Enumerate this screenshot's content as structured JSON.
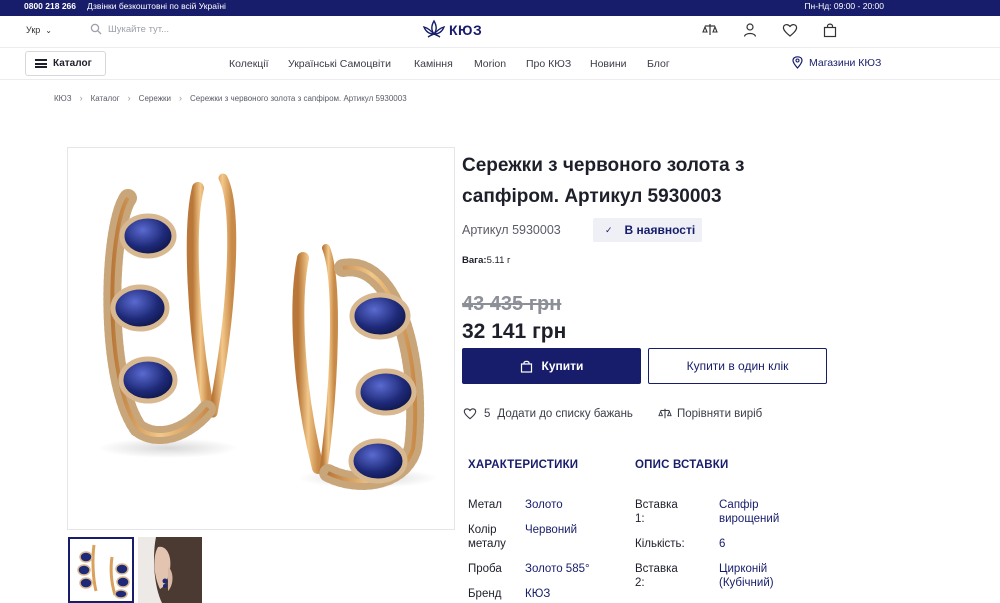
{
  "topbar": {
    "phone": "0800 218 266",
    "free_delivery": "Дзвінки безкоштовні по всій Україні",
    "hours": "Пн-Нд: 09:00 - 20:00"
  },
  "header": {
    "lang": "Укр",
    "search_placeholder": "Шукайте тут...",
    "logo": "КЮЗ"
  },
  "nav": {
    "catalog": "Каталог",
    "items": [
      "Колекції",
      "Українські Самоцвіти",
      "Каміння",
      "Morion",
      "Про КЮЗ",
      "Новини",
      "Блог"
    ],
    "stores": "Магазини КЮЗ"
  },
  "breadcrumbs": [
    "КЮЗ",
    "Каталог",
    "Сережки",
    "Сережки з червоного золота з сапфіром. Артикул 5930003"
  ],
  "product": {
    "title": "Сережки з червоного золота з сапфіром. Артикул 5930003",
    "article": "Артикул 5930003",
    "stock": "В наявності",
    "weight_label": "Вага:",
    "weight_value": "5.11 г",
    "old_price": "43 435 грн",
    "price": "32 141 грн",
    "buy": "Купити",
    "one_click": "Купити в один клік",
    "wish_count": "5",
    "wish_label": "Додати до списку бажань",
    "compare_label": "Порівняти виріб"
  },
  "specs": {
    "heading": "ХАРАКТЕРИСТИКИ",
    "rows": [
      {
        "label": "Метал",
        "value": "Золото"
      },
      {
        "label": "Колір\nметалу",
        "value": "Червоний"
      },
      {
        "label": "Проба",
        "value": "Золото 585°"
      },
      {
        "label": "Бренд",
        "value": "КЮЗ"
      }
    ]
  },
  "insert": {
    "heading": "ОПИС ВСТАВКИ",
    "rows": [
      {
        "label": "Вставка\n1:",
        "value": "Сапфір\nвирощений"
      },
      {
        "label": "Кількість:",
        "value": "6"
      },
      {
        "label": "Вставка\n2:",
        "value": "Цирконій\n(Кубічний)"
      }
    ]
  },
  "colors": {
    "brand": "#171d6b",
    "gold": "#d9a15c",
    "sapphire": "#1e2a78"
  }
}
